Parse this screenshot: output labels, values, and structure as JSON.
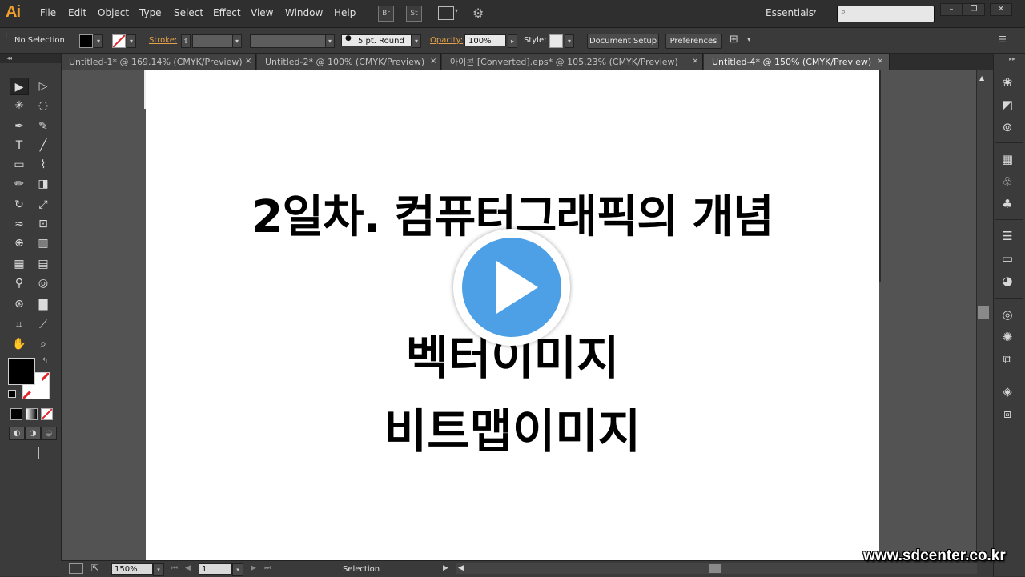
{
  "app": {
    "logo": "Ai"
  },
  "menu": [
    "File",
    "Edit",
    "Object",
    "Type",
    "Select",
    "Effect",
    "View",
    "Window",
    "Help"
  ],
  "menubar_icons": {
    "bridge": "Br",
    "stock": "St"
  },
  "workspace": "Essentials",
  "search": {
    "placeholder": ""
  },
  "window_controls": {
    "minimize": "–",
    "restore": "❐",
    "close": "✕"
  },
  "control_bar": {
    "selection": "No Selection",
    "stroke_label": "Stroke:",
    "brush": "5 pt. Round",
    "opacity_label": "Opacity:",
    "opacity_value": "100%",
    "style_label": "Style:",
    "document_setup": "Document Setup",
    "preferences": "Preferences"
  },
  "tabs": [
    {
      "label": "Untitled-1* @ 169.14% (CMYK/Preview)",
      "active": false
    },
    {
      "label": "Untitled-2* @ 100% (CMYK/Preview)",
      "active": false
    },
    {
      "label": "아이콘 [Converted].eps* @ 105.23% (CMYK/Preview)",
      "active": false
    },
    {
      "label": "Untitled-4* @ 150% (CMYK/Preview)",
      "active": true
    }
  ],
  "tab_close": "×",
  "artboard": {
    "title": "2일차. 컴퓨터그래픽의 개념",
    "line1": "벡터이미지",
    "line2": "비트맵이미지"
  },
  "status_bar": {
    "zoom": "150%",
    "artboard_number": "1",
    "status": "Selection"
  },
  "watermark": "www.sdcenter.co.kr",
  "colors": {
    "accent_orange": "#f1a02a",
    "play_blue": "#4d9fe6",
    "canvas_gray": "#535353",
    "panel_gray": "#3b3b3b"
  },
  "icons": {
    "selection": "▶",
    "direct_selection": "▷",
    "magic_wand": "✳",
    "lasso": "◌",
    "pen": "✒",
    "curvature": "✎",
    "type": "T",
    "line": "╱",
    "rectangle": "▭",
    "paintbrush": "⌇",
    "pencil": "✏",
    "eraser": "◨",
    "rotate": "↻",
    "scale": "⤢",
    "warp": "≈",
    "free_transform": "⊡",
    "shape_builder": "⊕",
    "chart": "▥",
    "mesh": "▦",
    "gradient": "▤",
    "eyedropper": "⚲",
    "blend": "◎",
    "symbol_sprayer": "⊛",
    "column_graph": "▇",
    "artboard": "⌗",
    "slice": "⟋",
    "hand": "✋",
    "zoom": "⌕"
  }
}
